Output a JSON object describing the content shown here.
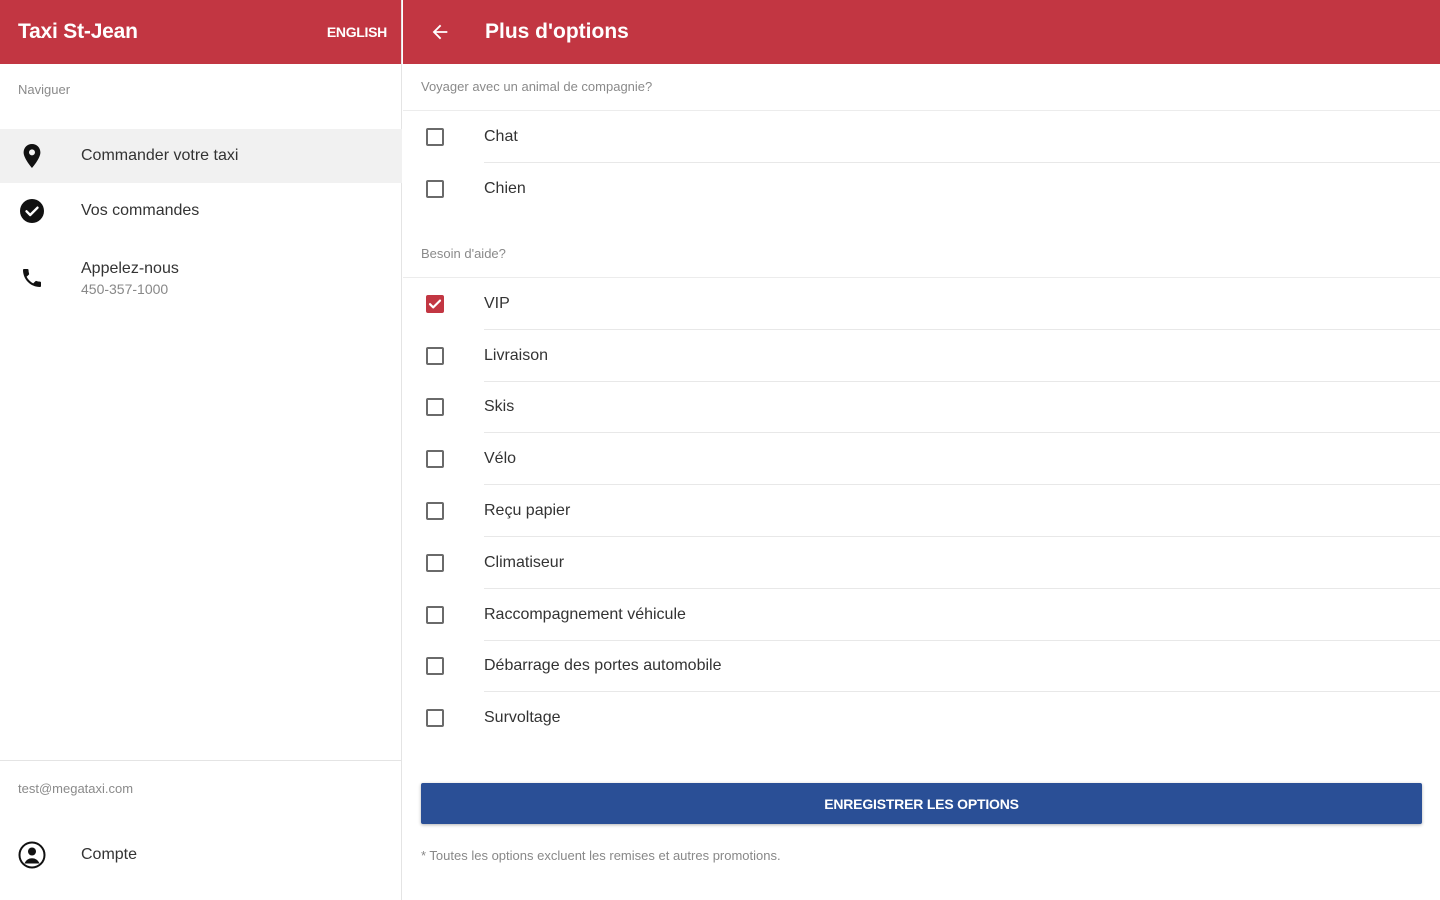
{
  "drawer": {
    "app_title": "Taxi St-Jean",
    "language_button": "ENGLISH",
    "nav_section_label": "Naviguer",
    "items": [
      {
        "label": "Commander votre taxi",
        "icon": "location-pin-icon"
      },
      {
        "label": "Vos commandes",
        "icon": "check-circle-icon"
      },
      {
        "label": "Appelez-nous",
        "sub": "450-357-1000",
        "icon": "phone-icon"
      }
    ],
    "account_email": "test@megataxi.com",
    "account_item": {
      "label": "Compte",
      "icon": "account-circle-icon"
    }
  },
  "main": {
    "title": "Plus d'options",
    "back_icon": "arrow-left-icon",
    "pets_section": {
      "label": "Voyager avec un animal de compagnie?",
      "options": [
        {
          "label": "Chat",
          "checked": false
        },
        {
          "label": "Chien",
          "checked": false
        }
      ]
    },
    "help_section": {
      "label": "Besoin d'aide?",
      "options": [
        {
          "label": "VIP",
          "checked": true
        },
        {
          "label": "Livraison",
          "checked": false
        },
        {
          "label": "Skis",
          "checked": false
        },
        {
          "label": "Vélo",
          "checked": false
        },
        {
          "label": "Reçu papier",
          "checked": false
        },
        {
          "label": "Climatiseur",
          "checked": false
        },
        {
          "label": "Raccompagnement véhicule",
          "checked": false
        },
        {
          "label": "Débarrage des portes automobile",
          "checked": false
        },
        {
          "label": "Survoltage",
          "checked": false
        }
      ]
    },
    "save_button": "ENREGISTRER LES OPTIONS",
    "footnote": "* Toutes les options excluent les remises et autres promotions."
  },
  "colors": {
    "header_red": "#c23642",
    "button_blue": "#2a4f96",
    "checkbox_checked": "#c23642"
  }
}
